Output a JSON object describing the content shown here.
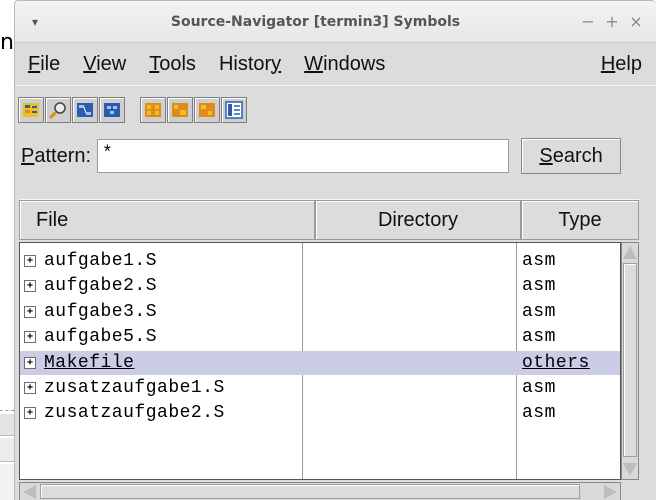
{
  "background": {
    "partial_letter": "n"
  },
  "window": {
    "title": "Source-Navigator [termin3] Symbols",
    "menu_glyph": "▾",
    "controls": {
      "minimize": "−",
      "maximize": "+",
      "close": "×"
    }
  },
  "menubar": {
    "items": [
      {
        "u": "F",
        "rest": "ile"
      },
      {
        "u": "V",
        "rest": "iew"
      },
      {
        "u": "T",
        "rest": "ools"
      },
      {
        "pre": "Histor",
        "u": "y"
      },
      {
        "u": "W",
        "rest": "indows"
      }
    ],
    "help": {
      "u": "H",
      "rest": "elp"
    }
  },
  "toolbar": {
    "icons": [
      "symbols-icon",
      "retriever-icon",
      "hierarchy-icon",
      "class-icon",
      "xref-icon",
      "include-icon",
      "editor-icon",
      "grep-icon"
    ],
    "colors": {
      "blue": "#2a5db0",
      "orange": "#e08a1e",
      "yellow": "#f0c020"
    }
  },
  "pattern": {
    "label_u": "P",
    "label_rest": "attern:",
    "value": "*",
    "search_u": "S",
    "search_rest": "earch"
  },
  "columns": {
    "file": "File",
    "directory": "Directory",
    "type": "Type"
  },
  "rows": [
    {
      "expander": "+",
      "file": "aufgabe1.S",
      "directory": "",
      "type": "asm",
      "selected": false
    },
    {
      "expander": "+",
      "file": "aufgabe2.S",
      "directory": "",
      "type": "asm",
      "selected": false
    },
    {
      "expander": "+",
      "file": "aufgabe3.S",
      "directory": "",
      "type": "asm",
      "selected": false
    },
    {
      "expander": "+",
      "file": "aufgabe5.S",
      "directory": "",
      "type": "asm",
      "selected": false
    },
    {
      "expander": "+",
      "file": "Makefile",
      "directory": "",
      "type": "others",
      "selected": true
    },
    {
      "expander": "+",
      "file": "zusatzaufgabe1.S",
      "directory": "",
      "type": "asm",
      "selected": false
    },
    {
      "expander": "+",
      "file": "zusatzaufgabe2.S",
      "directory": "",
      "type": "asm",
      "selected": false
    }
  ],
  "colors": {
    "selection": "#cbcde6",
    "window_bg": "#dcdcdc",
    "list_bg": "#ffffff"
  }
}
